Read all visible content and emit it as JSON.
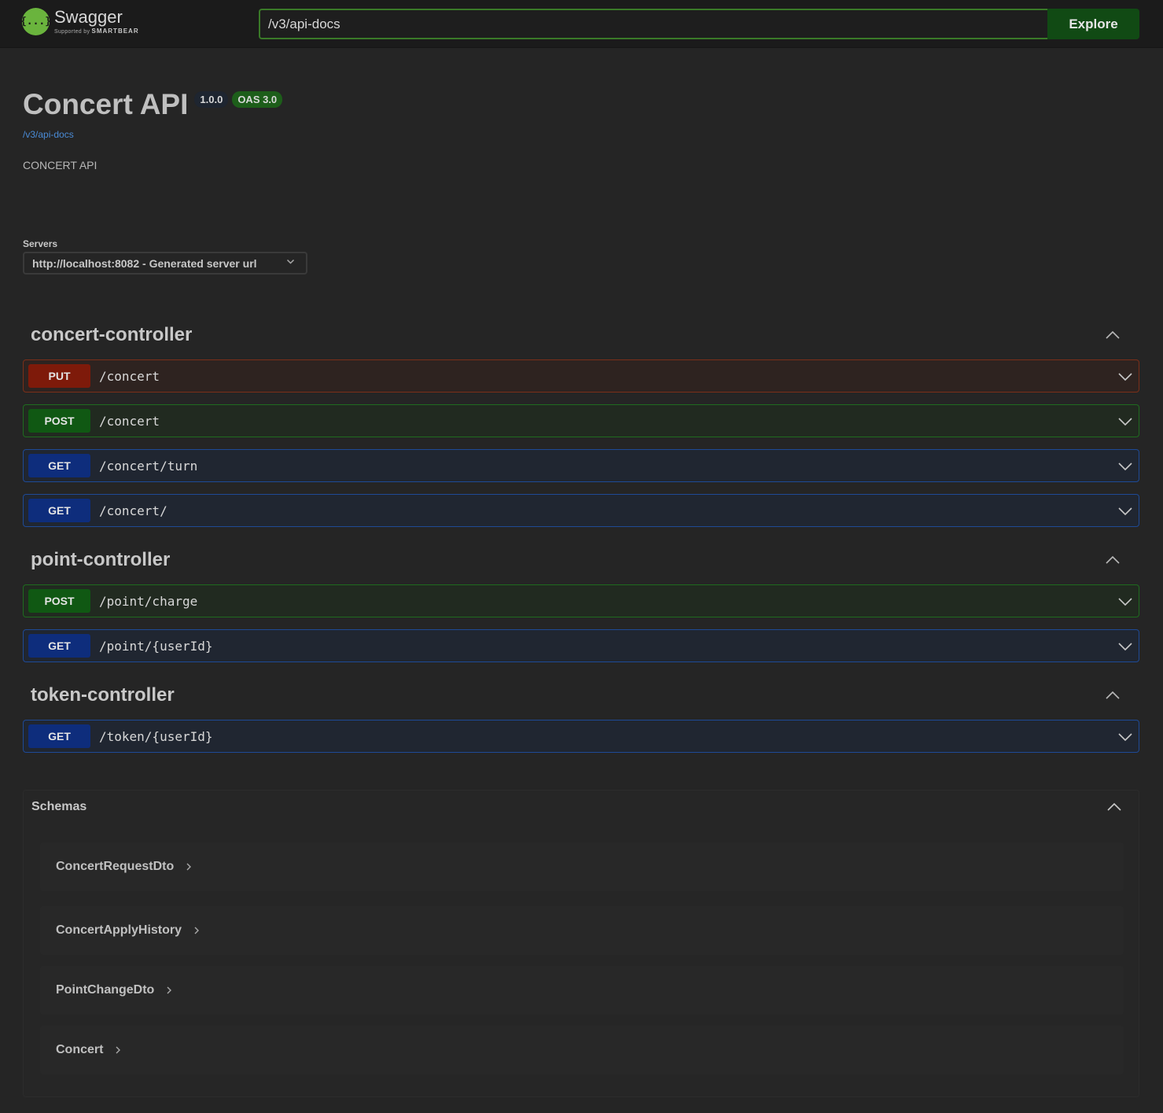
{
  "topbar": {
    "logo_glyph": "{...}",
    "logo_name": "Swagger",
    "logo_sub_prefix": "Supported by",
    "logo_sub_brand": "SMARTBEAR",
    "url_value": "/v3/api-docs",
    "explore_label": "Explore"
  },
  "info": {
    "title": "Concert API",
    "version": "1.0.0",
    "oas": "OAS 3.0",
    "spec_link": "/v3/api-docs",
    "description": "CONCERT API"
  },
  "servers": {
    "label": "Servers",
    "selected": "http://localhost:8082 - Generated server url"
  },
  "tags": [
    {
      "name": "concert-controller",
      "operations": [
        {
          "method": "PUT",
          "path": "/concert"
        },
        {
          "method": "POST",
          "path": "/concert"
        },
        {
          "method": "GET",
          "path": "/concert/turn"
        },
        {
          "method": "GET",
          "path": "/concert/"
        }
      ]
    },
    {
      "name": "point-controller",
      "operations": [
        {
          "method": "POST",
          "path": "/point/charge"
        },
        {
          "method": "GET",
          "path": "/point/{userId}"
        }
      ]
    },
    {
      "name": "token-controller",
      "operations": [
        {
          "method": "GET",
          "path": "/token/{userId}"
        }
      ]
    }
  ],
  "schemas": {
    "title": "Schemas",
    "items": [
      "ConcertRequestDto",
      "ConcertApplyHistory",
      "PointChangeDto",
      "Concert"
    ]
  },
  "colors": {
    "put": "#7e1a0a",
    "post": "#105813",
    "get": "#0e2d7c",
    "swagger_green": "#6ab43d"
  },
  "icons": {
    "logo": "swagger-logo-icon",
    "tag_toggle": "chevron-up-icon",
    "op_toggle": "chevron-down-icon",
    "schema_arrow": "chevron-right-icon",
    "select_arrow": "chevron-down-icon"
  }
}
